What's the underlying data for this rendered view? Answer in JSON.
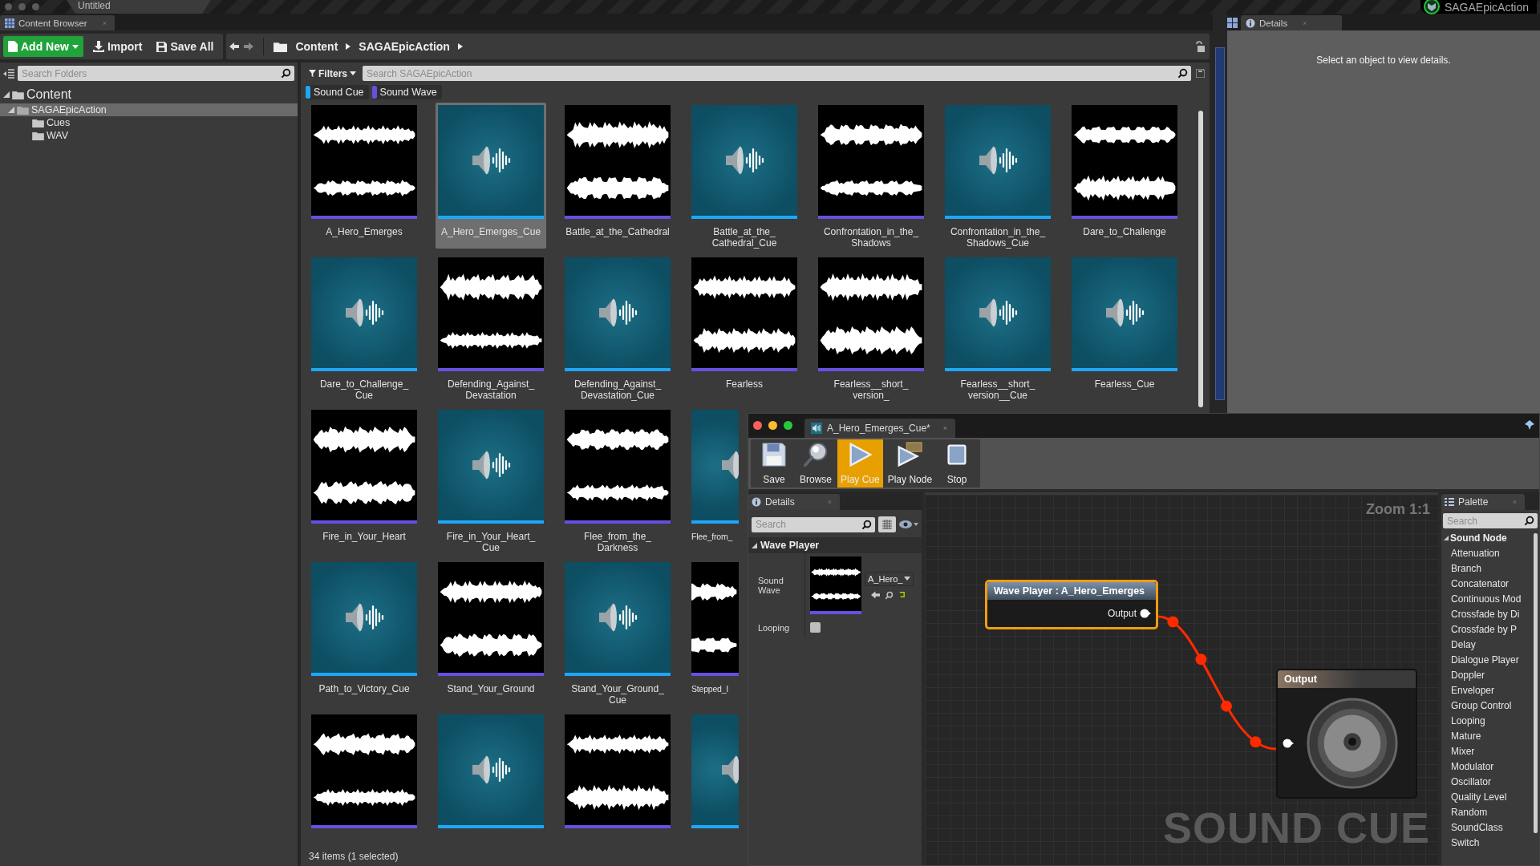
{
  "title_bar": {
    "tab": "Untitled",
    "project": "SAGAEpicAction"
  },
  "content_browser": {
    "tab": "Content Browser",
    "tab_close": "×",
    "toolbar": [
      {
        "label": "Add New",
        "kind": "add"
      },
      {
        "label": "Import",
        "kind": "import"
      },
      {
        "label": "Save All",
        "kind": "save"
      }
    ],
    "breadcrumb": [
      "Content",
      "SAGAEpicAction"
    ],
    "folder_search": {
      "placeholder": "Search Folders"
    },
    "folders": [
      {
        "label": "Content",
        "expanded": true,
        "selected": false,
        "children": [
          {
            "label": "SAGAEpicAction",
            "expanded": true,
            "selected": true,
            "children": [
              {
                "label": "Cues",
                "selected": false
              },
              {
                "label": "WAV",
                "selected": false
              }
            ]
          }
        ]
      }
    ],
    "filters_button": "Filters",
    "asset_search": {
      "placeholder": "Search SAGAEpicAction"
    },
    "filter_chips": [
      {
        "label": "Sound Cue",
        "color": "#1ea7f5"
      },
      {
        "label": "Sound Wave",
        "color": "#6a4ee0"
      }
    ],
    "asset_rows": [
      [
        {
          "label": "A_Hero_Emerges",
          "kind": "wave",
          "selected": false
        },
        {
          "label": "A_Hero_Emerges_Cue",
          "kind": "cue",
          "selected": true
        },
        {
          "label": "Battle_at_the_Cathedral",
          "kind": "wave",
          "selected": false
        },
        {
          "label": "Battle_at_the_Cathedral_Cue",
          "kind": "cue",
          "selected": false
        },
        {
          "label": "Confrontation_in_the_Shadows",
          "kind": "wave",
          "selected": false
        },
        {
          "label": "Confrontation_in_the_Shadows_Cue",
          "kind": "cue",
          "selected": false
        },
        {
          "label": "Dare_to_Challenge",
          "kind": "wave",
          "selected": false
        }
      ],
      [
        {
          "label": "Dare_to_Challenge_Cue",
          "kind": "cue",
          "selected": false
        },
        {
          "label": "Defending_Against_Devastation",
          "kind": "wave",
          "selected": false
        },
        {
          "label": "Defending_Against_Devastation_Cue",
          "kind": "cue",
          "selected": false
        },
        {
          "label": "Fearless",
          "kind": "wave",
          "selected": false
        },
        {
          "label": "Fearless__short_version_",
          "kind": "wave",
          "selected": false
        },
        {
          "label": "Fearless__short_version__Cue",
          "kind": "cue",
          "selected": false
        },
        {
          "label": "Fearless_Cue",
          "kind": "cue",
          "selected": false
        }
      ],
      [
        {
          "label": "Fire_in_Your_Heart",
          "kind": "wave",
          "selected": false
        },
        {
          "label": "Fire_in_Your_Heart_Cue",
          "kind": "cue",
          "selected": false
        },
        {
          "label": "Flee_from_the_Darkness",
          "kind": "wave",
          "selected": false
        },
        {
          "label": "Flee_from_",
          "kind": "cue",
          "selected": false,
          "cut": true
        }
      ],
      [
        {
          "label": "Path_to_Victory_Cue",
          "kind": "cue",
          "selected": false
        },
        {
          "label": "Stand_Your_Ground",
          "kind": "wave",
          "selected": false
        },
        {
          "label": "Stand_Your_Ground_Cue",
          "kind": "cue",
          "selected": false
        },
        {
          "label": "Stepped_I",
          "kind": "wave",
          "selected": false,
          "cut": true
        }
      ],
      [
        {
          "kind": "wave",
          "selected": false
        },
        {
          "kind": "cue",
          "selected": false
        },
        {
          "kind": "wave",
          "selected": false
        },
        {
          "kind": "cue",
          "selected": false,
          "cut": true
        }
      ]
    ],
    "status": "34 items (1 selected)"
  },
  "details_panel": {
    "tab": "Details",
    "tab_close": "×",
    "message": "Select an object to view details."
  },
  "sound_cue_editor": {
    "tab": "A_Hero_Emerges_Cue*",
    "tab_close": "×",
    "toolbar": [
      {
        "label": "Save",
        "kind": "save",
        "selected": false
      },
      {
        "label": "Browse",
        "kind": "browse",
        "selected": false
      },
      {
        "label": "Play Cue",
        "kind": "play",
        "selected": true
      },
      {
        "label": "Play Node",
        "kind": "play_node",
        "selected": false
      },
      {
        "label": "Stop",
        "kind": "stop",
        "selected": false
      }
    ],
    "details": {
      "tab": "Details",
      "tab_close": "×",
      "search": {
        "placeholder": "Search"
      },
      "section": "Wave Player",
      "properties": [
        {
          "kind": "asset",
          "label": "Sound Wave",
          "value": "A_Hero_"
        },
        {
          "kind": "checkbox",
          "label": "Looping",
          "checked": false
        }
      ]
    },
    "graph": {
      "zoom": "Zoom 1:1",
      "watermark": "SOUND CUE",
      "nodes": [
        {
          "kind": "wave_player",
          "title": "Wave Player : A_Hero_Emerges",
          "pin": "Output",
          "selected": true
        },
        {
          "kind": "output",
          "title": "Output",
          "selected": false
        }
      ]
    },
    "palette": {
      "tab": "Palette",
      "tab_close": "×",
      "search": {
        "placeholder": "Search"
      },
      "category": "Sound Node",
      "expanded": true,
      "items": [
        "Attenuation",
        "Branch",
        "Concatenator",
        "Continuous Mod",
        "Crossfade by Di",
        "Crossfade by P",
        "Delay",
        "Dialogue Player",
        "Doppler",
        "Enveloper",
        "Group Control",
        "Looping",
        "Mature",
        "Mixer",
        "Modulator",
        "Oscillator",
        "Quality Level",
        "Random",
        "SoundClass",
        "Switch"
      ]
    }
  }
}
